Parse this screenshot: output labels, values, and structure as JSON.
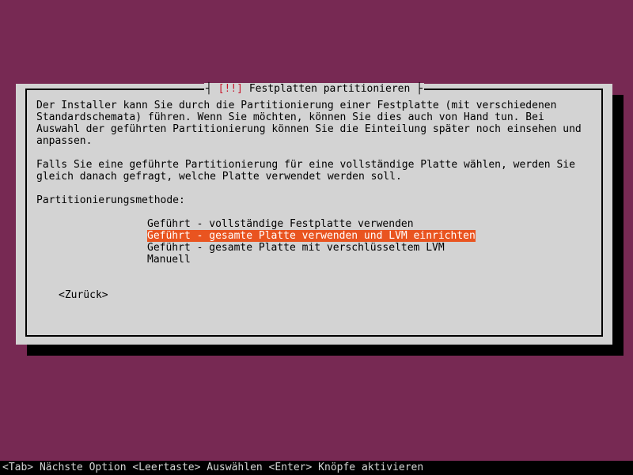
{
  "dialog": {
    "title_prefix": "[!!]",
    "title_text": "Festplatten partitionieren",
    "paragraph1": "Der Installer kann Sie durch die Partitionierung einer Festplatte (mit verschiedenen Standardschemata) führen. Wenn Sie möchten, können Sie dies auch von Hand tun. Bei Auswahl der geführten Partitionierung können Sie die Einteilung später noch einsehen und anpassen.",
    "paragraph2": "Falls Sie eine geführte Partitionierung für eine vollständige Platte wählen, werden Sie gleich danach gefragt, welche Platte verwendet werden soll.",
    "method_label": "Partitionierungsmethode:",
    "options": [
      "Geführt - vollständige Festplatte verwenden",
      "Geführt - gesamte Platte verwenden und LVM einrichten",
      "Geführt - gesamte Platte mit verschlüsseltem LVM",
      "Manuell"
    ],
    "selected_index": 1,
    "back_label": "<Zurück>"
  },
  "help_bar": "<Tab> Nächste Option <Leertaste> Auswählen <Enter> Knöpfe aktivieren"
}
